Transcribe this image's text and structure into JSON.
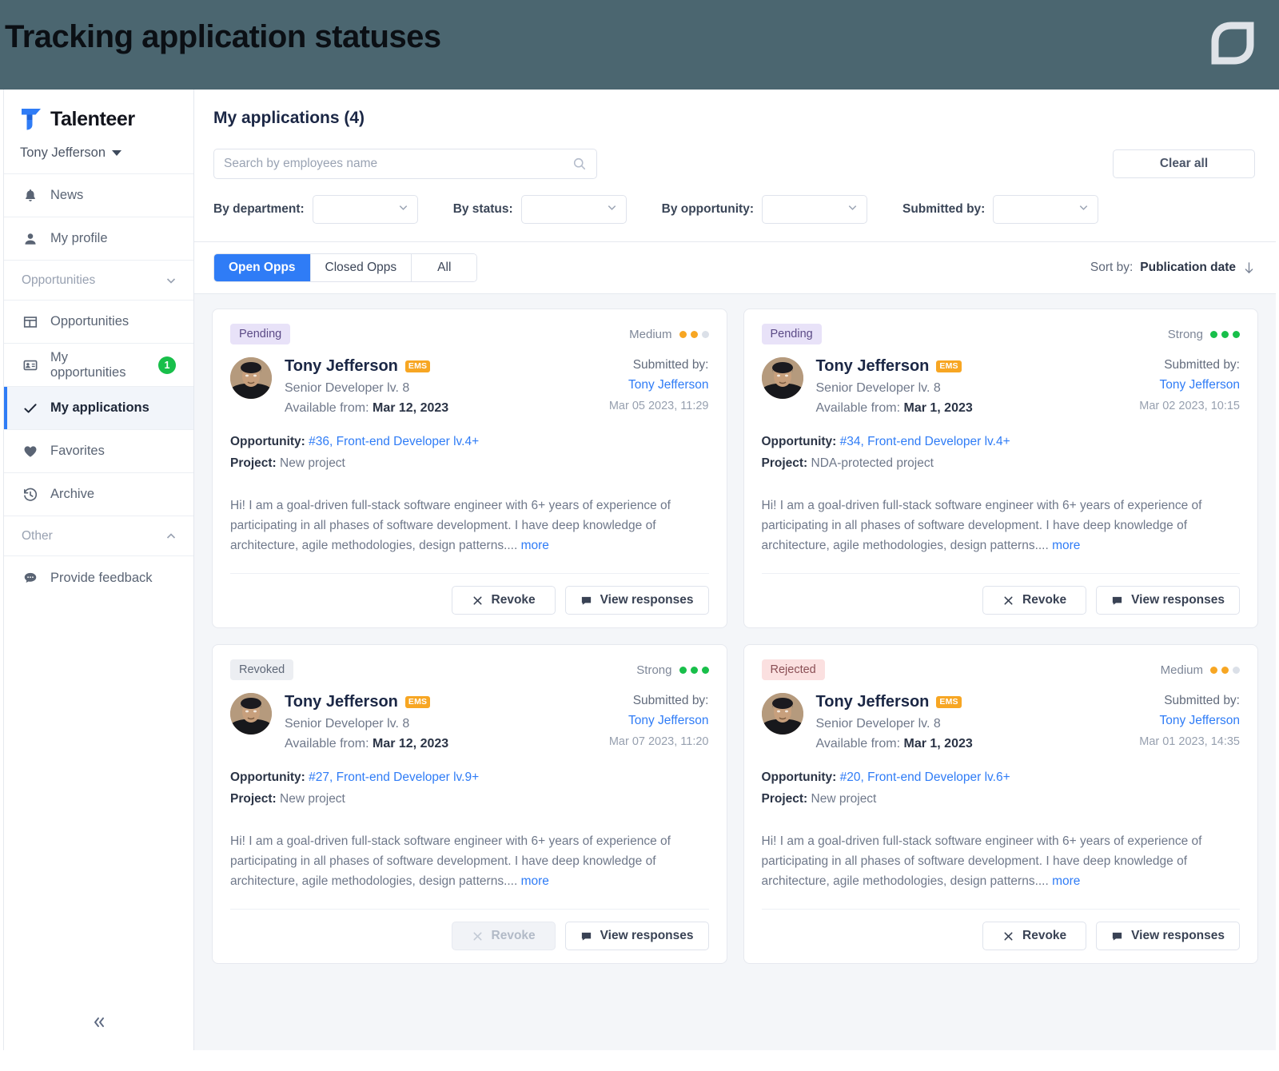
{
  "banner": {
    "title": "Tracking application statuses",
    "logo_icon": "leaf-logo-icon",
    "bg_color": "#4b6670"
  },
  "sidebar": {
    "brand": {
      "name": "Talenteer",
      "logo_icon": "talenteer-logo-icon"
    },
    "user": {
      "name": "Tony Jefferson",
      "caret_icon": "caret-down-icon"
    },
    "items": [
      {
        "label": "News",
        "icon": "bell-icon",
        "active": false,
        "badge": ""
      },
      {
        "label": "My profile",
        "icon": "user-icon",
        "active": false,
        "badge": ""
      }
    ],
    "groups": [
      {
        "label": "Opportunities",
        "chevron_icon": "chevron-down-icon",
        "items": [
          {
            "label": "Opportunities",
            "icon": "grid-icon",
            "active": false,
            "badge": ""
          },
          {
            "label": "My opportunities",
            "icon": "id-card-icon",
            "active": false,
            "badge": "1"
          },
          {
            "label": "My applications",
            "icon": "check-icon",
            "active": true,
            "badge": ""
          },
          {
            "label": "Favorites",
            "icon": "heart-icon",
            "active": false,
            "badge": ""
          },
          {
            "label": "Archive",
            "icon": "history-icon",
            "active": false,
            "badge": ""
          }
        ]
      },
      {
        "label": "Other",
        "chevron_icon": "chevron-up-icon",
        "items": [
          {
            "label": "Provide feedback",
            "icon": "chat-bubble-icon",
            "active": false,
            "badge": ""
          }
        ]
      }
    ],
    "collapse_icon": "chevrons-left-icon",
    "badge_color": "#18bf4a",
    "active_accent": "#2f7cf6"
  },
  "main": {
    "panel_title": "My applications (4)",
    "search": {
      "placeholder": "Search by employees name",
      "value": "",
      "icon": "search-icon"
    },
    "clear_all_label": "Clear all",
    "filters": [
      {
        "label": "By department:",
        "value": "",
        "chevron_icon": "chevron-down-icon"
      },
      {
        "label": "By status:",
        "value": "",
        "chevron_icon": "chevron-down-icon"
      },
      {
        "label": "By opportunity:",
        "value": "",
        "chevron_icon": "chevron-down-icon"
      },
      {
        "label": "Submitted by:",
        "value": "",
        "chevron_icon": "chevron-down-icon"
      }
    ],
    "tabs": [
      {
        "label": "Open Opps",
        "active": true
      },
      {
        "label": "Closed Opps",
        "active": false
      },
      {
        "label": "All",
        "active": false
      }
    ],
    "sort": {
      "label": "Sort by:",
      "value": "Publication date",
      "arrow_icon": "arrow-down-icon"
    },
    "cards": [
      {
        "status": "Pending",
        "status_kind": "pending",
        "strength_label": "Medium",
        "strength_filled": 2,
        "strength_total": 3,
        "strength_color": "#f7a623",
        "person_name": "Tony Jefferson",
        "badge": "EMS",
        "role": "Senior Developer lv. 8",
        "available_label": "Available from:",
        "available_value": "Mar 12, 2023",
        "submitted_label": "Submitted by:",
        "submitted_name": "Tony Jefferson",
        "submitted_date": "Mar 05 2023, 11:29",
        "opportunity_label": "Opportunity:",
        "opportunity_value": "#36, Front-end Developer lv.4+",
        "project_label": "Project:",
        "project_value": "New project",
        "excerpt": "Hi! I am a goal-driven full-stack software engineer with 6+ years of experience of participating in all phases of software development. I have deep knowledge of architecture, agile methodologies, design patterns....",
        "more_label": "more",
        "revoke_label": "Revoke",
        "revoke_icon": "close-x-icon",
        "revoke_disabled": false,
        "responses_label": "View responses",
        "responses_icon": "comment-icon"
      },
      {
        "status": "Pending",
        "status_kind": "pending",
        "strength_label": "Strong",
        "strength_filled": 3,
        "strength_total": 3,
        "strength_color": "#18bf4a",
        "person_name": "Tony Jefferson",
        "badge": "EMS",
        "role": "Senior Developer lv. 8",
        "available_label": "Available from:",
        "available_value": "Mar 1, 2023",
        "submitted_label": "Submitted by:",
        "submitted_name": "Tony Jefferson",
        "submitted_date": "Mar 02 2023, 10:15",
        "opportunity_label": "Opportunity:",
        "opportunity_value": "#34, Front-end Developer lv.4+",
        "project_label": "Project:",
        "project_value": "NDA-protected project",
        "excerpt": "Hi! I am a goal-driven full-stack software engineer with 6+ years of experience of participating in all phases of software development. I have deep knowledge of architecture, agile methodologies, design patterns....",
        "more_label": "more",
        "revoke_label": "Revoke",
        "revoke_icon": "close-x-icon",
        "revoke_disabled": false,
        "responses_label": "View responses",
        "responses_icon": "comment-icon"
      },
      {
        "status": "Revoked",
        "status_kind": "revoked",
        "strength_label": "Strong",
        "strength_filled": 3,
        "strength_total": 3,
        "strength_color": "#18bf4a",
        "person_name": "Tony Jefferson",
        "badge": "EMS",
        "role": "Senior Developer lv. 8",
        "available_label": "Available from:",
        "available_value": "Mar 12, 2023",
        "submitted_label": "Submitted by:",
        "submitted_name": "Tony Jefferson",
        "submitted_date": "Mar 07 2023, 11:20",
        "opportunity_label": "Opportunity:",
        "opportunity_value": "#27, Front-end Developer lv.9+",
        "project_label": "Project:",
        "project_value": "New project",
        "excerpt": "Hi! I am a goal-driven full-stack software engineer with 6+ years of experience of participating in all phases of software development. I have deep knowledge of architecture, agile methodologies, design patterns....",
        "more_label": "more",
        "revoke_label": "Revoke",
        "revoke_icon": "close-x-icon",
        "revoke_disabled": true,
        "responses_label": "View responses",
        "responses_icon": "comment-icon"
      },
      {
        "status": "Rejected",
        "status_kind": "rejected",
        "strength_label": "Medium",
        "strength_filled": 2,
        "strength_total": 3,
        "strength_color": "#f7a623",
        "person_name": "Tony Jefferson",
        "badge": "EMS",
        "role": "Senior Developer lv. 8",
        "available_label": "Available from:",
        "available_value": "Mar 1, 2023",
        "submitted_label": "Submitted by:",
        "submitted_name": "Tony Jefferson",
        "submitted_date": "Mar 01 2023, 14:35",
        "opportunity_label": "Opportunity:",
        "opportunity_value": "#20, Front-end Developer lv.6+",
        "project_label": "Project:",
        "project_value": "New project",
        "excerpt": "Hi! I am a goal-driven full-stack software engineer with 6+ years of experience of participating in all phases of software development. I have deep knowledge of architecture, agile methodologies, design patterns....",
        "more_label": "more",
        "revoke_label": "Revoke",
        "revoke_icon": "close-x-icon",
        "revoke_disabled": false,
        "responses_label": "View responses",
        "responses_icon": "comment-icon"
      }
    ]
  }
}
